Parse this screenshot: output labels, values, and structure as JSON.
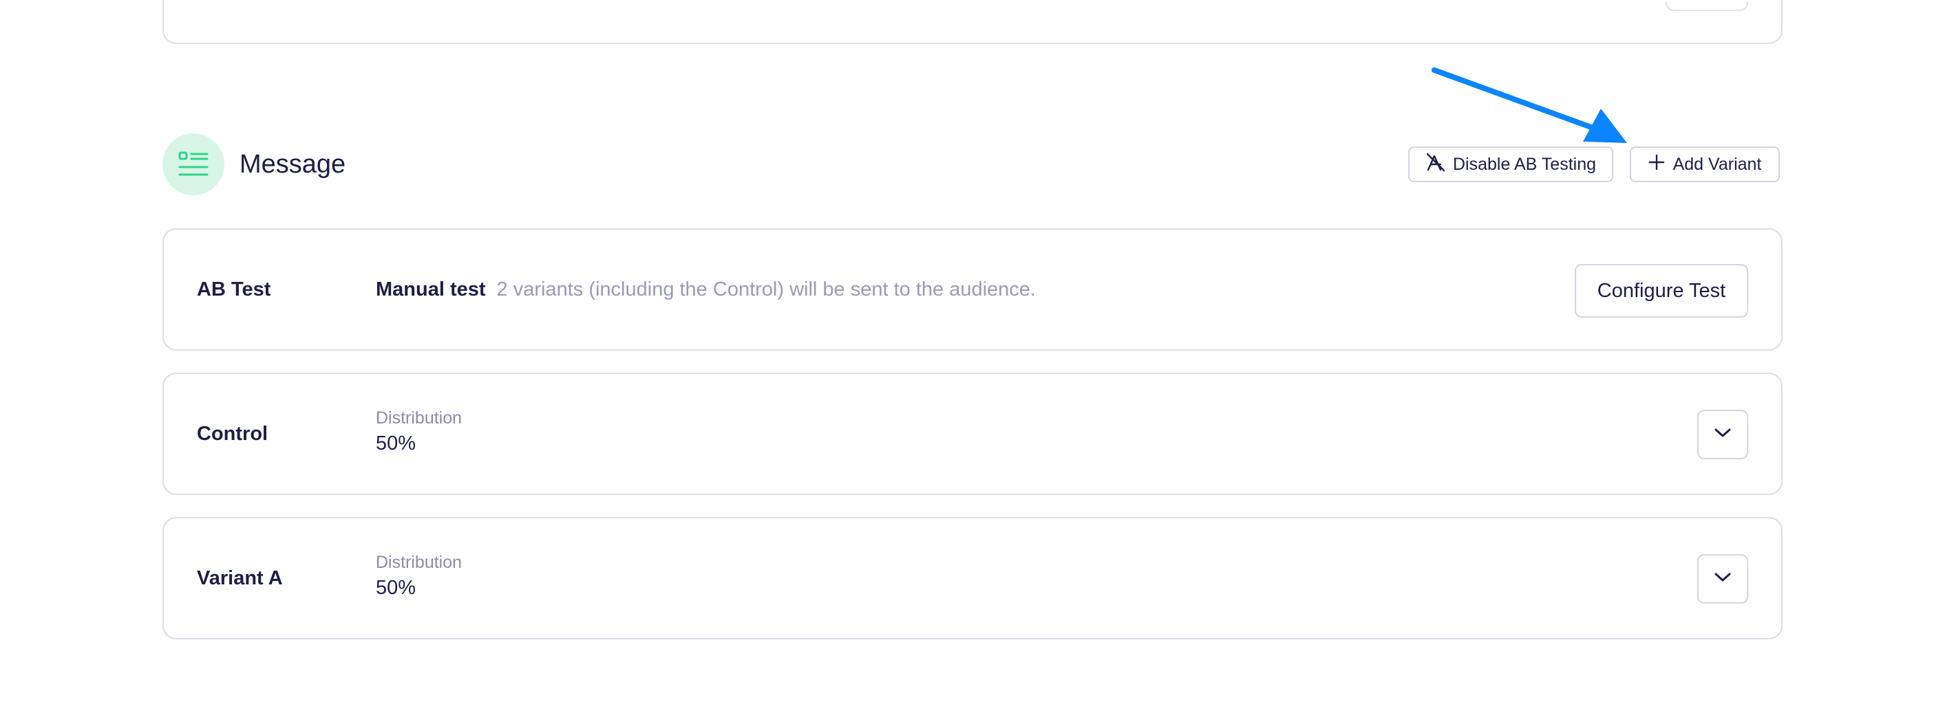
{
  "section": {
    "title": "Message",
    "icon": "list-icon",
    "icon_color": "#2fd38a",
    "icon_bg": "#d8f6e7"
  },
  "actions": {
    "disable_ab_label": "Disable AB Testing",
    "disable_ab_icon": "split-off-icon",
    "add_variant_label": "Add Variant",
    "add_variant_icon": "plus-icon"
  },
  "annotation": {
    "arrow_color": "#0a84ff",
    "points_to": "add-variant-button"
  },
  "ab_test": {
    "label": "AB Test",
    "mode": "Manual test",
    "description": "2 variants (including the Control) will be sent to the audience.",
    "configure_label": "Configure Test"
  },
  "variants": [
    {
      "name": "Control",
      "distribution_label": "Distribution",
      "distribution_value": "50%"
    },
    {
      "name": "Variant A",
      "distribution_label": "Distribution",
      "distribution_value": "50%"
    }
  ]
}
